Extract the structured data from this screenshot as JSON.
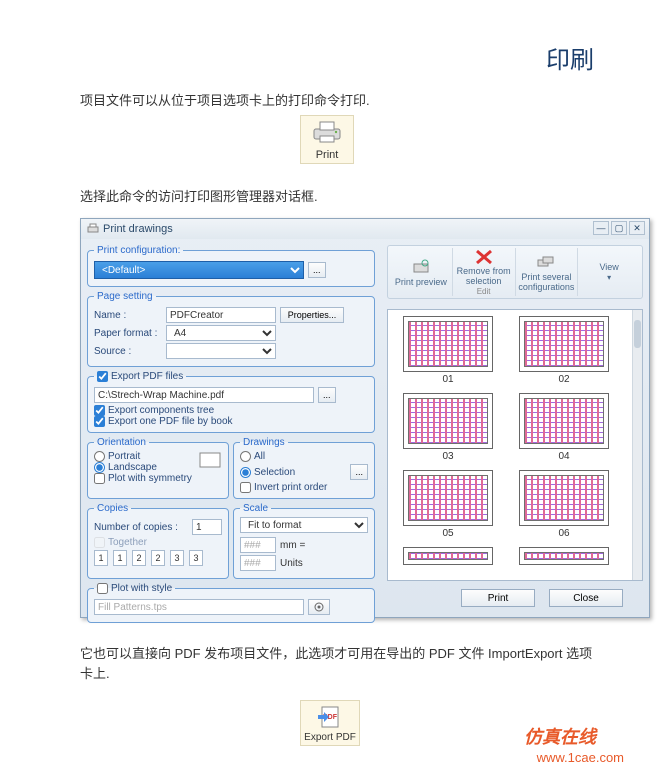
{
  "page": {
    "title": "印刷",
    "para1": "项目文件可以从位于项目选项卡上的打印命令打印.",
    "para2": "选择此命令的访问打印图形管理器对话框.",
    "para3_part1": "它也可以直接向 PDF 发布项目文件，此选项才可用在导出的 PDF 文件 ImportExport 选项卡上.",
    "print_btn_label": "Print",
    "export_pdf_label": "Export PDF"
  },
  "dialog": {
    "title": "Print drawings",
    "printcfg": {
      "legend": "Print configuration:",
      "value": "<Default>",
      "more": "..."
    },
    "pagesetting": {
      "legend": "Page setting",
      "name_lbl": "Name :",
      "name_val": "PDFCreator",
      "properties": "Properties...",
      "paper_lbl": "Paper format :",
      "paper_val": "A4",
      "source_lbl": "Source :",
      "source_val": ""
    },
    "exportpdf": {
      "chk_files": "Export PDF files",
      "path": "C:\\Strech-Wrap Machine.pdf",
      "more": "...",
      "chk_tree": "Export components tree",
      "chk_book": "Export one PDF file by book"
    },
    "orientation": {
      "legend": "Orientation",
      "portrait": "Portrait",
      "landscape": "Landscape",
      "plotsym": "Plot with symmetry"
    },
    "drawings": {
      "legend": "Drawings",
      "all": "All",
      "selection": "Selection",
      "more": "...",
      "invert": "Invert print order"
    },
    "copies": {
      "legend": "Copies",
      "num_lbl": "Number of copies :",
      "num_val": "1",
      "together": "Together",
      "cells": [
        "1",
        "1",
        "2",
        "2",
        "3",
        "3"
      ]
    },
    "scale": {
      "legend": "Scale",
      "fit": "Fit to format",
      "val_a": "###",
      "unit_a": "mm =",
      "val_b": "###",
      "unit_b": "Units"
    },
    "plotstyle": {
      "chk": "Plot with style",
      "val": "Fill Patterns.tps"
    },
    "toolbar": {
      "preview": "Print preview",
      "remove": "Remove from selection",
      "several": "Print several configurations",
      "view": "View",
      "edit": "Edit"
    },
    "thumbs": [
      "01",
      "02",
      "03",
      "04",
      "05",
      "06"
    ],
    "footer": {
      "print": "Print",
      "close": "Close"
    }
  },
  "watermarks": {
    "w1": "仿真在线",
    "w2": "www.1cae.com"
  }
}
